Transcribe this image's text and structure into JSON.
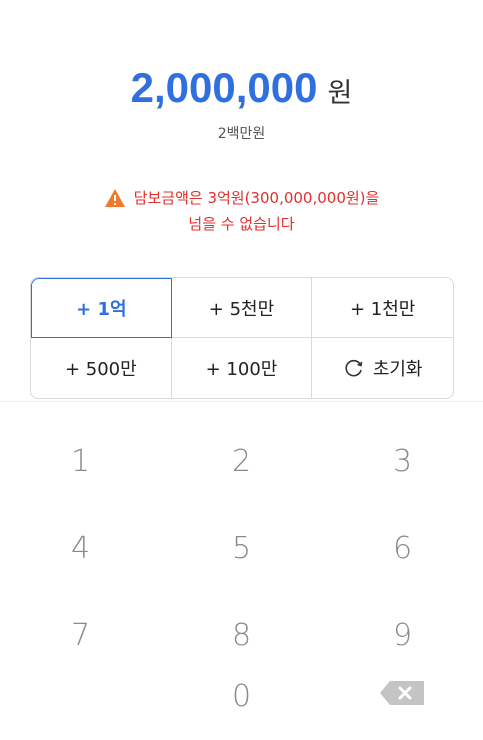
{
  "amount": {
    "value": "2,000,000",
    "unit": "원",
    "korean": "2백만원"
  },
  "warning": {
    "line1": "담보금액은 3억원(300,000,000원)을",
    "line2": "넘을 수 없습니다",
    "color": "#e0302e"
  },
  "quick_buttons": [
    {
      "label": "+ 1억",
      "active": true
    },
    {
      "label": "+ 5천만",
      "active": false
    },
    {
      "label": "+ 1천만",
      "active": false
    },
    {
      "label": "+ 500만",
      "active": false
    },
    {
      "label": "+ 100만",
      "active": false
    },
    {
      "label": "초기화",
      "icon": "refresh-icon",
      "active": false
    }
  ],
  "keypad": {
    "k1": "1",
    "k2": "2",
    "k3": "3",
    "k4": "4",
    "k5": "5",
    "k6": "6",
    "k7": "7",
    "k8": "8",
    "k9": "9",
    "k0": "0",
    "backspace_icon": "backspace-icon"
  },
  "colors": {
    "accent": "#2f6fdf",
    "warning": "#e0302e",
    "border": "#dadada"
  }
}
